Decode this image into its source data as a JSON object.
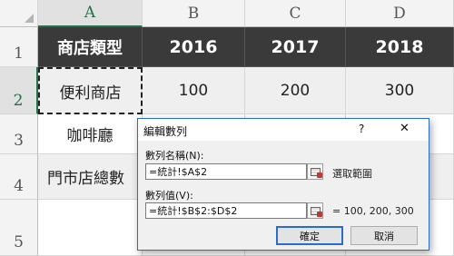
{
  "columns": [
    "A",
    "B",
    "C",
    "D"
  ],
  "rows": [
    "1",
    "2",
    "3",
    "4",
    "5"
  ],
  "cells": {
    "A1": "商店類型",
    "B1": "2016",
    "C1": "2017",
    "D1": "2018",
    "A2": "便利商店",
    "B2": "100",
    "C2": "200",
    "D2": "300",
    "A3": "咖啡廳",
    "A4": "門市店總數"
  },
  "dialog": {
    "title": "編輯數列",
    "help": "?",
    "close": "✕",
    "name_label": "數列名稱(N):",
    "name_value": "=統計!$A$2",
    "name_hint": "選取範圍",
    "values_label": "數列值(V):",
    "values_value": "=統計!$B$2:$D$2",
    "values_preview": "= 100, 200, 300",
    "ok_label": "確定",
    "cancel_label": "取消"
  },
  "colors": {
    "header_dark": "#3a3a3a",
    "row_light": "#efefef",
    "dialog_accent": "#2b6cc4"
  }
}
